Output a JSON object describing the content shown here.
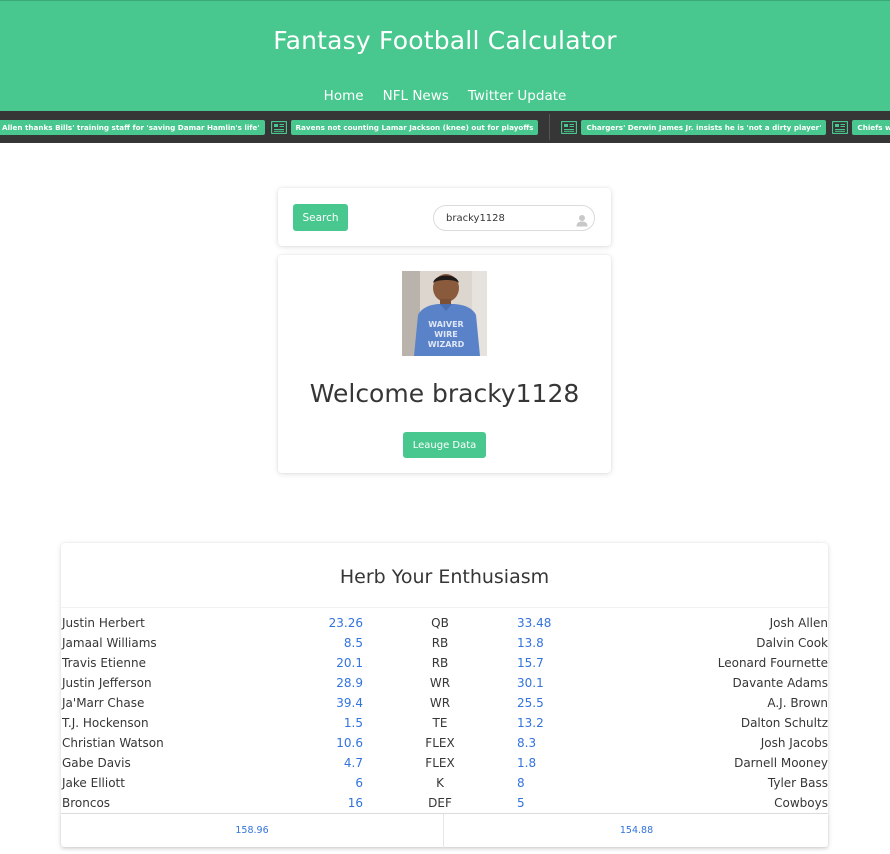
{
  "header": {
    "title": "Fantasy Football Calculator",
    "nav": [
      "Home",
      "NFL News",
      "Twitter Update"
    ]
  },
  "ticker": {
    "items": [
      "Allen thanks Bills' training staff for 'saving Damar Hamlin's life'",
      "Ravens not counting Lamar Jackson (knee) out for playoffs",
      "Chargers' Derwin James Jr. insists he is 'not a dirty player'",
      "Chiefs would be top seed"
    ]
  },
  "search": {
    "button_label": "Search",
    "value": "bracky1128",
    "placeholder": ""
  },
  "profile": {
    "welcome": "Welcome bracky1128",
    "shirt_text": [
      "WAIVER",
      "WIRE",
      "WIZARD"
    ],
    "league_button": "Leauge Data"
  },
  "matchup": {
    "title": "Herb Your Enthusiasm",
    "rows": [
      {
        "name1": "Justin Herbert",
        "pts1": "23.26",
        "pos": "QB",
        "pts2": "33.48",
        "name2": "Josh Allen"
      },
      {
        "name1": "Jamaal Williams",
        "pts1": "8.5",
        "pos": "RB",
        "pts2": "13.8",
        "name2": "Dalvin Cook"
      },
      {
        "name1": "Travis Etienne",
        "pts1": "20.1",
        "pos": "RB",
        "pts2": "15.7",
        "name2": "Leonard Fournette"
      },
      {
        "name1": "Justin Jefferson",
        "pts1": "28.9",
        "pos": "WR",
        "pts2": "30.1",
        "name2": "Davante Adams"
      },
      {
        "name1": "Ja'Marr Chase",
        "pts1": "39.4",
        "pos": "WR",
        "pts2": "25.5",
        "name2": "A.J. Brown"
      },
      {
        "name1": "T.J. Hockenson",
        "pts1": "1.5",
        "pos": "TE",
        "pts2": "13.2",
        "name2": "Dalton Schultz"
      },
      {
        "name1": "Christian Watson",
        "pts1": "10.6",
        "pos": "FLEX",
        "pts2": "8.3",
        "name2": "Josh Jacobs"
      },
      {
        "name1": "Gabe Davis",
        "pts1": "4.7",
        "pos": "FLEX",
        "pts2": "1.8",
        "name2": "Darnell Mooney"
      },
      {
        "name1": "Jake Elliott",
        "pts1": "6",
        "pos": "K",
        "pts2": "8",
        "name2": "Tyler Bass"
      },
      {
        "name1": "Broncos",
        "pts1": "16",
        "pos": "DEF",
        "pts2": "5",
        "name2": "Cowboys"
      }
    ],
    "total_left": "158.96",
    "total_right": "154.88"
  },
  "colors": {
    "primary": "#48c78e",
    "ticker_bg": "#363636",
    "link": "#3273dc"
  }
}
